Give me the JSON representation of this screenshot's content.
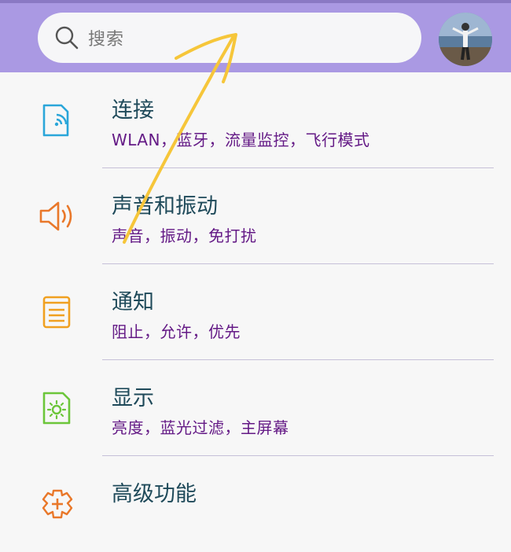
{
  "search": {
    "placeholder": "搜索"
  },
  "settings": {
    "items": [
      {
        "title": "连接",
        "subtitle": "WLAN，蓝牙，流量监控，飞行模式",
        "icon": "connection-icon",
        "color": "#2aa6d9"
      },
      {
        "title": "声音和振动",
        "subtitle": "声音，振动，免打扰",
        "icon": "speaker-icon",
        "color": "#e9782a"
      },
      {
        "title": "通知",
        "subtitle": "阻止，允许，优先",
        "icon": "notification-icon",
        "color": "#f0a020"
      },
      {
        "title": "显示",
        "subtitle": "亮度，蓝光过滤，主屏幕",
        "icon": "display-brightness-icon",
        "color": "#6cc63a"
      },
      {
        "title": "高级功能",
        "subtitle": "",
        "icon": "advanced-features-icon",
        "color": "#e9782a"
      }
    ]
  },
  "colors": {
    "header": "#aa99e3",
    "title_text": "#1f4a5a",
    "subtitle_text": "#641a86",
    "gesture_overlay": "#f6c63a"
  }
}
